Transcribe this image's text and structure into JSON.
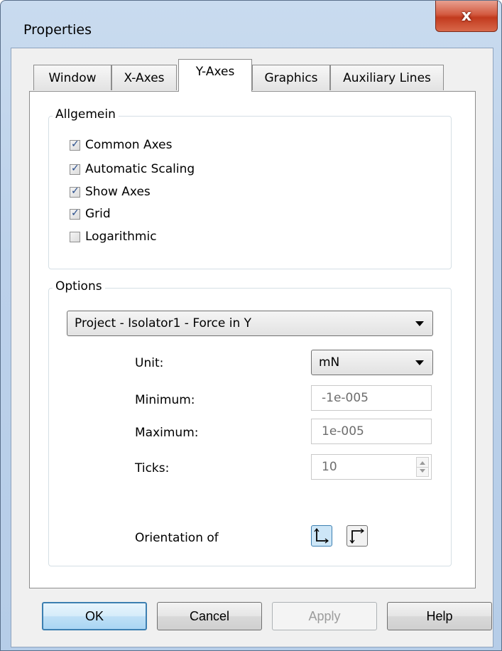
{
  "window": {
    "title": "Properties",
    "close_glyph": "x"
  },
  "tabs": [
    {
      "label": "Window",
      "active": false
    },
    {
      "label": "X-Axes",
      "active": false
    },
    {
      "label": "Y-Axes",
      "active": true
    },
    {
      "label": "Graphics",
      "active": false
    },
    {
      "label": "Auxiliary Lines",
      "active": false
    }
  ],
  "allgemein": {
    "title": "Allgemein",
    "checkboxes": [
      {
        "label": "Common Axes",
        "checked": true
      },
      {
        "label": "Automatic Scaling",
        "checked": true
      },
      {
        "label": "Show Axes",
        "checked": true
      },
      {
        "label": "Grid",
        "checked": true
      },
      {
        "label": "Logarithmic",
        "checked": false
      }
    ]
  },
  "options": {
    "title": "Options",
    "signal_selected": "Project - Isolator1 - Force in Y",
    "unit_label": "Unit:",
    "unit_value": "mN",
    "minimum_label": "Minimum:",
    "minimum_value": "-1e-005",
    "maximum_label": "Maximum:",
    "maximum_value": "1e-005",
    "ticks_label": "Ticks:",
    "ticks_value": "10",
    "orientation_label": "Orientation of",
    "orientation_selected": "bottom-left"
  },
  "buttons": {
    "ok": "OK",
    "cancel": "Cancel",
    "apply": "Apply",
    "help": "Help"
  },
  "colors": {
    "accent": "#3c7fb1",
    "close": "#c23a1e",
    "check": "#254b8a"
  },
  "icons": {
    "close": "close-icon",
    "orient_a": "axis-origin-bottom-left-icon",
    "orient_b": "axis-origin-top-left-icon"
  }
}
